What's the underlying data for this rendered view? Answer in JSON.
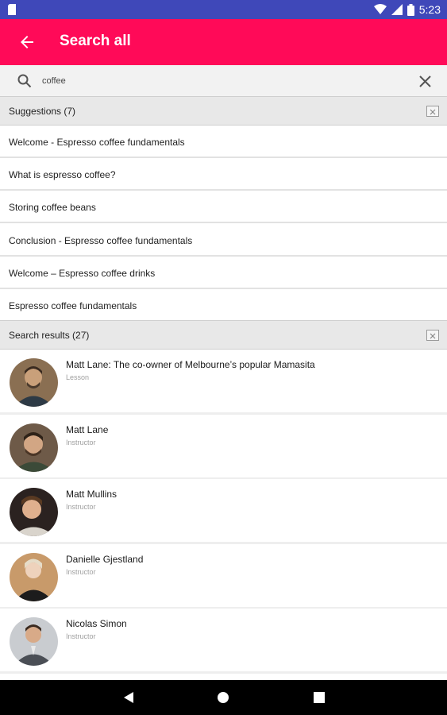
{
  "status": {
    "time": "5:23"
  },
  "appbar": {
    "title": "Search all"
  },
  "search": {
    "value": "coffee"
  },
  "suggestions": {
    "header": "Suggestions (7)",
    "items": [
      "Welcome - Espresso coffee fundamentals",
      "What is espresso coffee?",
      "Storing coffee beans",
      "Conclusion - Espresso coffee fundamentals",
      "Welcome – Espresso coffee drinks",
      "Espresso coffee fundamentals"
    ]
  },
  "results": {
    "header": "Search results (27)",
    "items": [
      {
        "name": "Matt Lane: The co-owner of Melbourne’s popular Mamasita",
        "type": "Lesson"
      },
      {
        "name": "Matt Lane",
        "type": "Instructor"
      },
      {
        "name": "Matt Mullins",
        "type": "Instructor"
      },
      {
        "name": "Danielle Gjestland",
        "type": "Instructor"
      },
      {
        "name": "Nicolas Simon",
        "type": "Instructor"
      }
    ]
  },
  "colors": {
    "status_bar": "#3f48b9",
    "app_bar": "#ff0a58",
    "section_header": "#e8e8e8"
  }
}
